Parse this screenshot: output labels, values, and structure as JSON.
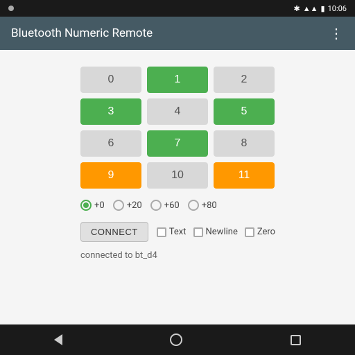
{
  "statusBar": {
    "time": "10:06",
    "bluetooth": "BT",
    "signal": "signal",
    "battery": "battery"
  },
  "appBar": {
    "title": "Bluetooth Numeric Remote",
    "moreIcon": "⋮"
  },
  "numpad": {
    "buttons": [
      {
        "label": "0",
        "state": "default"
      },
      {
        "label": "1",
        "state": "green"
      },
      {
        "label": "2",
        "state": "default"
      },
      {
        "label": "3",
        "state": "green"
      },
      {
        "label": "4",
        "state": "default"
      },
      {
        "label": "5",
        "state": "green"
      },
      {
        "label": "6",
        "state": "default"
      },
      {
        "label": "7",
        "state": "green"
      },
      {
        "label": "8",
        "state": "default"
      },
      {
        "label": "9",
        "state": "orange"
      },
      {
        "label": "10",
        "state": "default"
      },
      {
        "label": "11",
        "state": "orange"
      }
    ]
  },
  "radioGroup": {
    "options": [
      {
        "label": "+0",
        "selected": true
      },
      {
        "label": "+20",
        "selected": false
      },
      {
        "label": "+60",
        "selected": false
      },
      {
        "label": "+80",
        "selected": false
      }
    ]
  },
  "connectRow": {
    "connectLabel": "CONNECT",
    "checkboxes": [
      {
        "label": "Text",
        "checked": false
      },
      {
        "label": "Newline",
        "checked": false
      },
      {
        "label": "Zero",
        "checked": false
      }
    ]
  },
  "statusMessage": "connected to bt_d4",
  "navbar": {
    "back": "back",
    "home": "home",
    "recents": "recents"
  }
}
